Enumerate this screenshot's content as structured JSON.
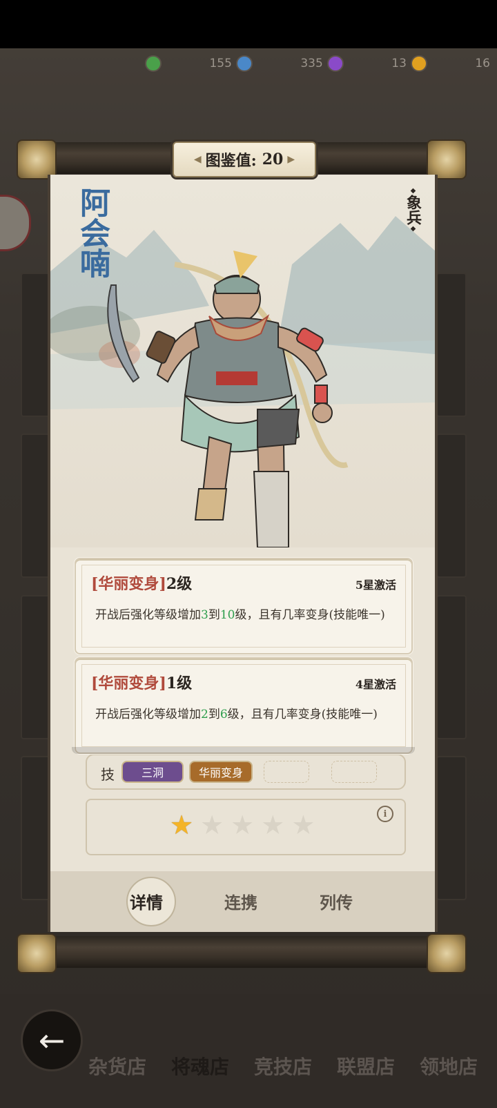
{
  "currency": [
    {
      "value": "155",
      "color": "#4aa04a"
    },
    {
      "value": "335",
      "color": "#4a88c8"
    },
    {
      "value": "13",
      "color": "#8a4ac8"
    },
    {
      "value": "16",
      "color": "#e0a020"
    }
  ],
  "title": {
    "label": "图鉴值:",
    "value": "20"
  },
  "hero": {
    "name": "阿会喃",
    "unit_type": "象兵"
  },
  "skills": [
    {
      "name": "华丽变身",
      "level": "2级",
      "unlock": "5星激活",
      "desc_1": "开战后强化等级增加",
      "num_a": "3",
      "to": "到",
      "num_b": "10",
      "desc_2": "级，且有几率变身(技能唯一)"
    },
    {
      "name": "华丽变身",
      "level": "1级",
      "unlock": "4星激活",
      "desc_1": "开战后强化等级增加",
      "num_a": "2",
      "to": "到",
      "num_b": "6",
      "desc_2": "级，且有几率变身(技能唯一)"
    }
  ],
  "skill_row": {
    "label": "技",
    "chips": [
      "三洞",
      "华丽变身"
    ]
  },
  "stars": {
    "filled": 1,
    "total": 5
  },
  "tabs": [
    "详情",
    "连携",
    "列传"
  ],
  "bottom_nav": [
    "杂货店",
    "将魂店",
    "竞技店",
    "联盟店",
    "领地店"
  ]
}
